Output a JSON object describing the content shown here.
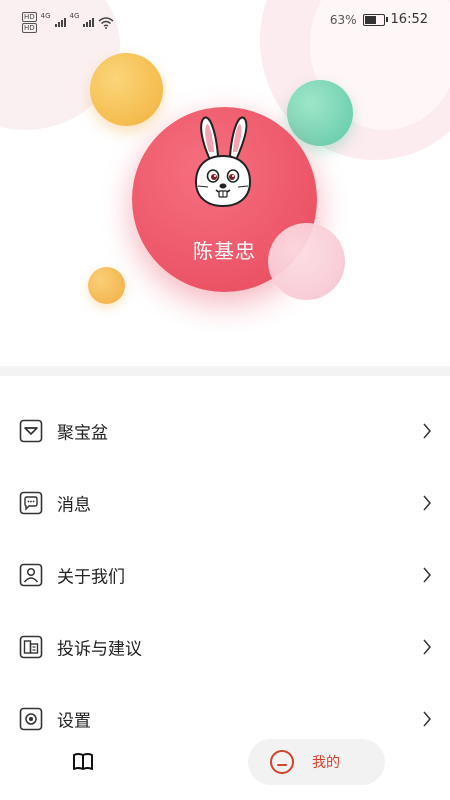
{
  "status_bar": {
    "signal_tags": [
      "HD",
      "HD"
    ],
    "network_1": "4G",
    "network_2": "4G",
    "battery_percent": "63%",
    "battery_level": 0.63,
    "time": "16:52",
    "icons": [
      "hd-icon",
      "signal-icon",
      "signal-icon",
      "wifi-icon",
      "battery-icon"
    ]
  },
  "profile": {
    "username": "陈基忠",
    "avatar_icon": "rabbit-avatar-icon",
    "accent_color": "#e8485c"
  },
  "menu": {
    "items": [
      {
        "label": "聚宝盆",
        "icon": "treasure-bowl-icon"
      },
      {
        "label": "消息",
        "icon": "message-icon"
      },
      {
        "label": "关于我们",
        "icon": "about-us-icon"
      },
      {
        "label": "投诉与建议",
        "icon": "complaint-icon"
      },
      {
        "label": "设置",
        "icon": "settings-icon"
      }
    ],
    "chevron_icon": "chevron-right-icon"
  },
  "tabbar": {
    "book_icon": "book-icon",
    "mine_label": "我的",
    "mine_icon": "mine-face-icon",
    "active_color": "#d4432e"
  }
}
